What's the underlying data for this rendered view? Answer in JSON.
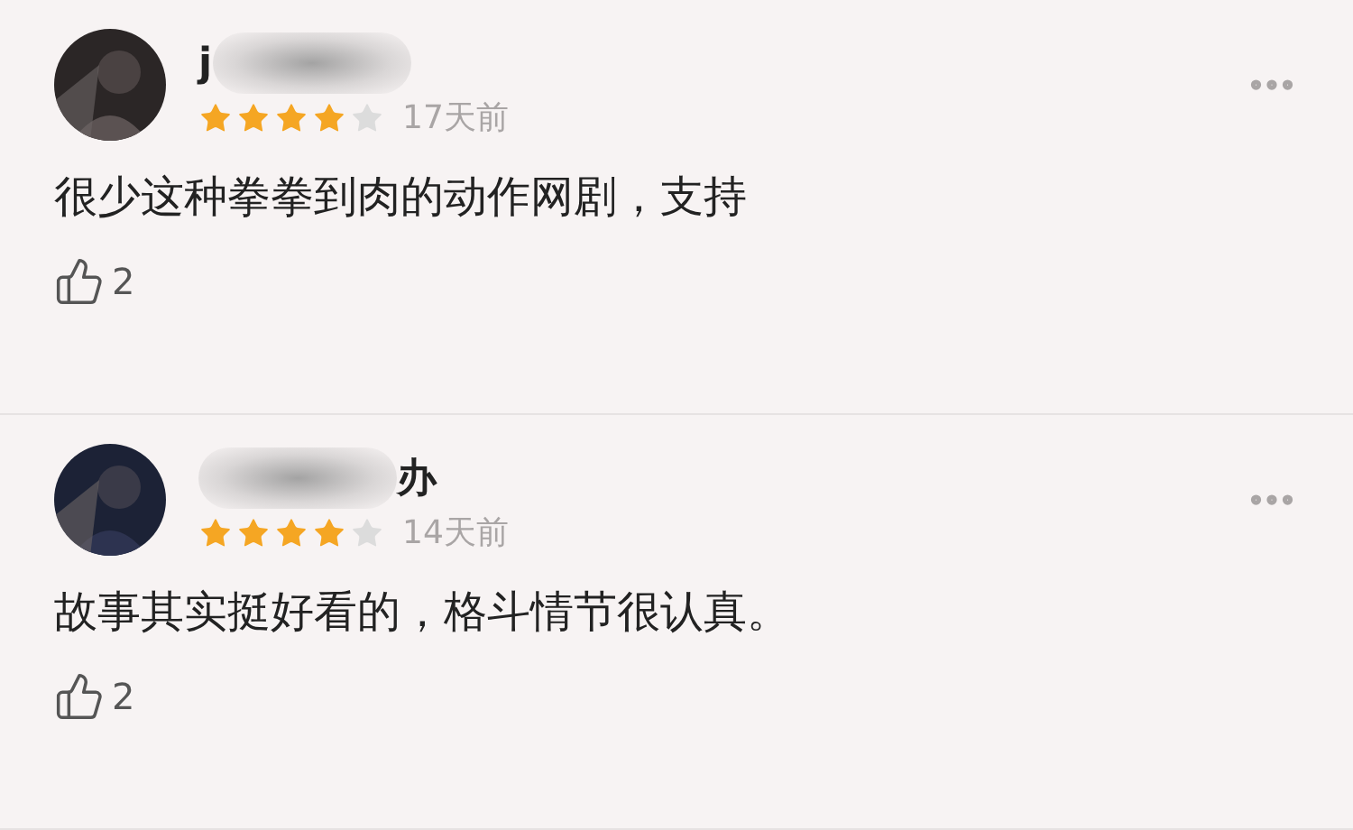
{
  "comments": [
    {
      "name_parts": [
        {
          "kind": "text",
          "text": "j"
        },
        {
          "kind": "smudge"
        }
      ],
      "stars": 4,
      "time": "17天前",
      "text": "很少这种拳拳到肉的动作网剧，支持",
      "likes": "2"
    },
    {
      "name_parts": [
        {
          "kind": "smudge"
        },
        {
          "kind": "text",
          "text": "办"
        }
      ],
      "stars": 4,
      "time": "14天前",
      "text": "故事其实挺好看的，格斗情节很认真。",
      "likes": "2"
    }
  ]
}
